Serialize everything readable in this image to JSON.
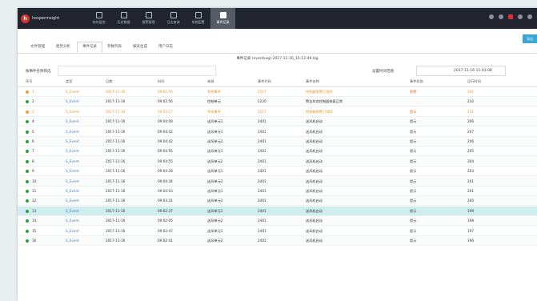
{
  "app": {
    "logo_text": "hospermsight"
  },
  "nav": [
    {
      "label": "实时监控",
      "icon": "monitor-icon"
    },
    {
      "label": "历史数据",
      "icon": "history-icon"
    },
    {
      "label": "报警管理",
      "icon": "alarm-icon"
    },
    {
      "label": "日志查询",
      "icon": "log-icon"
    },
    {
      "label": "系统配置",
      "icon": "config-icon"
    },
    {
      "label": "事件记录",
      "icon": "event-icon",
      "active": true
    }
  ],
  "tabs": [
    "文件管理",
    "趋势分析",
    "事件记录",
    "参数列表",
    "报表生成",
    "用户日志"
  ],
  "active_tab": 2,
  "action_button": "导出",
  "caption": "事件记录 (eventLog) 2017-11-16_15-13-49.log",
  "filter": {
    "label": "按事件名称筛选",
    "value": ""
  },
  "time": {
    "label": "设置时间范围",
    "value": "2017-11-16 11:03:08"
  },
  "columns": [
    "序号",
    "类型",
    "日期",
    "时间",
    "来源",
    "事件代码",
    "事件名称",
    "事件状态",
    "运行时间"
  ],
  "rows": [
    {
      "status": "warn",
      "n": "1",
      "type": "S_Event",
      "date": "2017-11-16",
      "time": "09:01:56",
      "src": "系统事件",
      "code": "2217",
      "name": "控制器报警已消除",
      "state": "报警",
      "runtime": "202"
    },
    {
      "status": "ok",
      "n": "2",
      "type": "S_Event",
      "date": "2017-11-16",
      "time": "09:02:56",
      "src": "控制单元",
      "code": "2220",
      "name": "警告状态控制器恢复正常",
      "state": "",
      "runtime": "232"
    },
    {
      "status": "warn",
      "n": "3",
      "type": "S_Event",
      "date": "2017-11-16",
      "time": "09:03:17",
      "src": "系统事件",
      "code": "2217",
      "name": "控制器报警已消除",
      "state": "提示",
      "runtime": "231"
    },
    {
      "status": "ok",
      "n": "4",
      "type": "S_Event",
      "date": "2017-11-16",
      "time": "09:04:08",
      "src": "送风单元1",
      "code": "2401",
      "name": "送风机启动",
      "state": "提示",
      "runtime": "206"
    },
    {
      "status": "ok",
      "n": "5",
      "type": "S_Event",
      "date": "2017-11-16",
      "time": "09:04:42",
      "src": "送风单元1",
      "code": "2401",
      "name": "送风机启动",
      "state": "提示",
      "runtime": "207"
    },
    {
      "status": "ok",
      "n": "6",
      "type": "S_Event",
      "date": "2017-11-16",
      "time": "09:04:42",
      "src": "送风单元2",
      "code": "2401",
      "name": "送风机启动",
      "state": "提示",
      "runtime": "206"
    },
    {
      "status": "ok",
      "n": "7",
      "type": "S_Event",
      "date": "2017-11-16",
      "time": "09:04:55",
      "src": "送风单元1",
      "code": "2401",
      "name": "送风机启动",
      "state": "提示",
      "runtime": "205"
    },
    {
      "status": "ok",
      "n": "8",
      "type": "S_Event",
      "date": "2017-11-16",
      "time": "09:04:55",
      "src": "送风单元2",
      "code": "2401",
      "name": "送风机启动",
      "state": "提示",
      "runtime": "204"
    },
    {
      "status": "ok",
      "n": "9",
      "type": "S_Event",
      "date": "2017-11-16",
      "time": "09:04:28",
      "src": "送风单元1",
      "code": "2401",
      "name": "送风机启动",
      "state": "提示",
      "runtime": "203"
    },
    {
      "status": "ok",
      "n": "10",
      "type": "S_Event",
      "date": "2017-11-16",
      "time": "09:04:34",
      "src": "送风单元2",
      "code": "2401",
      "name": "送风机启动",
      "state": "提示",
      "runtime": "201"
    },
    {
      "status": "ok",
      "n": "11",
      "type": "S_Event",
      "date": "2017-11-16",
      "time": "09:04:03",
      "src": "送风单元1",
      "code": "2401",
      "name": "送风机启动",
      "state": "提示",
      "runtime": "201"
    },
    {
      "status": "ok",
      "n": "12",
      "type": "S_Event",
      "date": "2017-11-16",
      "time": "09:03:31",
      "src": "送风单元2",
      "code": "2401",
      "name": "送风机启动",
      "state": "提示",
      "runtime": "200"
    },
    {
      "status": "sel",
      "n": "13",
      "type": "S_Event",
      "date": "2017-11-16",
      "time": "09:02:37",
      "src": "送风单元1",
      "code": "2401",
      "name": "送风机启动",
      "state": "提示",
      "runtime": "199"
    },
    {
      "status": "ok",
      "n": "14",
      "type": "S_Event",
      "date": "2017-11-16",
      "time": "09:02:05",
      "src": "送风单元2",
      "code": "2401",
      "name": "送风机启动",
      "state": "提示",
      "runtime": "198"
    },
    {
      "status": "ok",
      "n": "15",
      "type": "S_Event",
      "date": "2017-11-16",
      "time": "09:02:47",
      "src": "送风单元1",
      "code": "2401",
      "name": "送风机启动",
      "state": "提示",
      "runtime": "197"
    },
    {
      "status": "ok",
      "n": "16",
      "type": "S_Event",
      "date": "2017-11-16",
      "time": "09:02:41",
      "src": "送风单元2",
      "code": "2401",
      "name": "送风机启动",
      "state": "提示",
      "runtime": "196"
    }
  ]
}
